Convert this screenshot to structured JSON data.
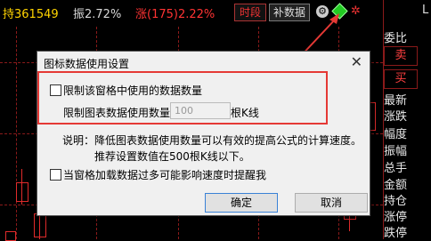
{
  "topbar": {
    "hold": "持361549",
    "vibration": "振2.72%",
    "change": "涨(175)2.22%",
    "period_button": "时段",
    "supplement_button": "补数据"
  },
  "right_panel": {
    "top_letter": "L",
    "wei_bi": "委比",
    "sell": "卖",
    "buy": "买",
    "items": [
      "最新",
      "涨跌",
      "幅度",
      "振幅",
      "总手",
      "金额",
      "持仓",
      "涨停",
      "跌停"
    ]
  },
  "dialog": {
    "title": "图标数据使用设置",
    "close_glyph": "✕",
    "limit_checkbox_label": "限制该窗格中使用的数据数量",
    "limit_count_label": "限制图表数据使用数量",
    "count_value": "100",
    "count_unit": "根K线",
    "note_line1": "说明：降低图表数据使用数量可以有效的提高公式的计算速度。",
    "note_line2": "推荐设置数值在500根K线以下。",
    "alert_checkbox_label": "当窗格加载数据过多可能影响速度时提醒我",
    "ok_button": "确定",
    "cancel_button": "取消"
  },
  "colors": {
    "highlight": "#e53935",
    "up": "#ff3333",
    "grid": "#8b1a1a",
    "accent_green": "#22cc22"
  }
}
